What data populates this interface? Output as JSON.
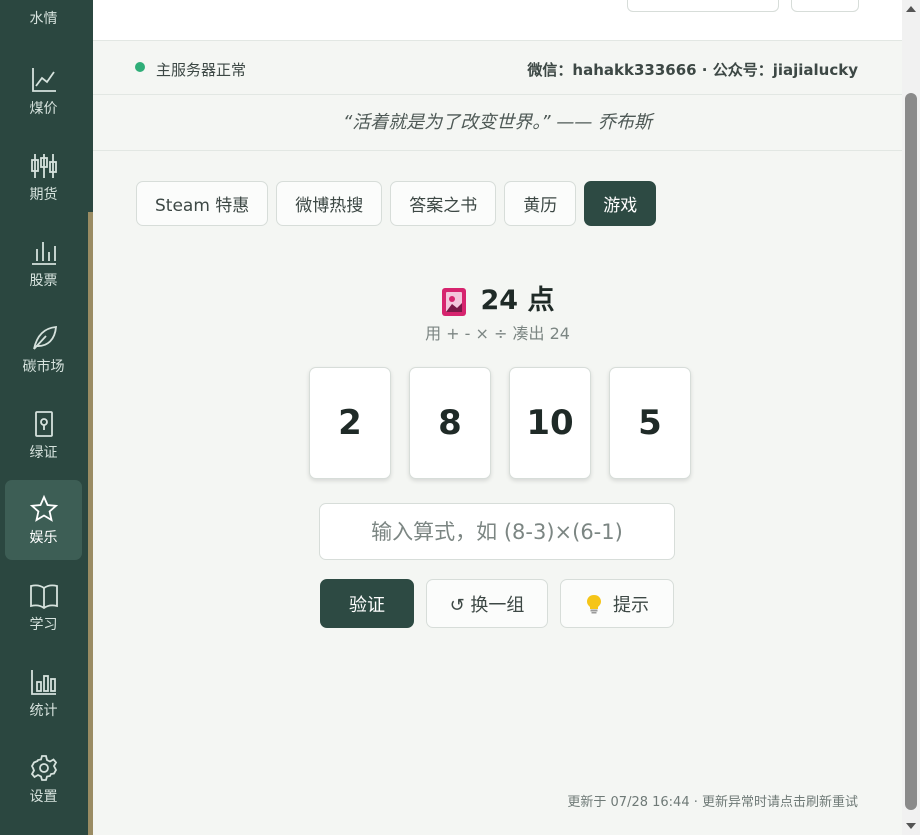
{
  "sidebar": {
    "partial_item_label": "水情",
    "items": [
      {
        "label": "煤价",
        "icon": "line-chart-icon"
      },
      {
        "label": "期货",
        "icon": "candlestick-icon"
      },
      {
        "label": "股票",
        "icon": "bar-chart-icon"
      },
      {
        "label": "碳市场",
        "icon": "leaf-icon"
      },
      {
        "label": "绿证",
        "icon": "certificate-icon"
      },
      {
        "label": "娱乐",
        "icon": "star-icon",
        "active": true
      },
      {
        "label": "学习",
        "icon": "book-icon"
      },
      {
        "label": "统计",
        "icon": "stats-icon"
      },
      {
        "label": "设置",
        "icon": "gear-icon"
      }
    ]
  },
  "status": {
    "server_text": "主服务器正常",
    "contact_text": "微信：hahakk333666 · 公众号：jiajialucky",
    "status_color": "#2fae78"
  },
  "quote": "“活着就是为了改变世界。” —— 乔布斯",
  "tabs": [
    "Steam 特惠",
    "微博热搜",
    "答案之书",
    "黄历",
    "游戏"
  ],
  "active_tab": "游戏",
  "game": {
    "title": "24 点",
    "icon": "playing-card-icon",
    "subtitle": "用 + - × ÷ 凑出 24",
    "cards": [
      "2",
      "8",
      "10",
      "5"
    ],
    "input_placeholder": "输入算式，如 (8-3)×(6-1)",
    "verify_label": "验证",
    "shuffle_label": "↺ 换一组",
    "hint_label": "提示",
    "hint_icon": "lightbulb-icon"
  },
  "footer": "更新于 07/28 16:44 · 更新异常时请点击刷新重试",
  "colors": {
    "sidebar_bg": "#2b4740",
    "accent": "#2d4a43",
    "active_nav": "#3d5e55"
  }
}
